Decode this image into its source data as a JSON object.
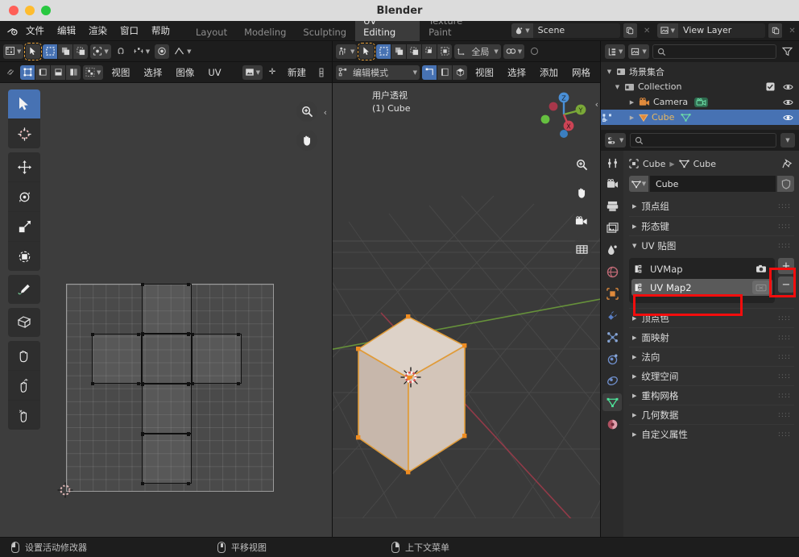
{
  "window": {
    "title": "Blender"
  },
  "topbar": {
    "menus": [
      "文件",
      "编辑",
      "渲染",
      "窗口",
      "帮助"
    ],
    "workspaces": [
      {
        "label": "Layout",
        "active": false
      },
      {
        "label": "Modeling",
        "active": false
      },
      {
        "label": "Sculpting",
        "active": false
      },
      {
        "label": "UV Editing",
        "active": true
      },
      {
        "label": "Texture Paint",
        "active": false
      }
    ],
    "scene": {
      "label": "Scene"
    },
    "view_layer": {
      "label": "View Layer"
    }
  },
  "uv_editor": {
    "header_row2": {
      "menus": [
        "视图",
        "选择",
        "图像",
        "UV"
      ],
      "new_button": "新建"
    }
  },
  "viewport": {
    "header_row2": {
      "mode": "编辑模式",
      "menus": [
        "视图",
        "选择",
        "添加",
        "网格"
      ]
    },
    "header_row1": {
      "orientation": "全局"
    },
    "overlay_text_line1": "用户透视",
    "overlay_text_line2": "(1) Cube",
    "gizmo_axes": [
      "X",
      "Y",
      "Z"
    ]
  },
  "outliner": {
    "root": "场景集合",
    "items": [
      {
        "label": "Collection",
        "type": "collection",
        "selected": false
      },
      {
        "label": "Camera",
        "type": "camera",
        "selected": false
      },
      {
        "label": "Cube",
        "type": "mesh",
        "selected": true
      }
    ]
  },
  "properties": {
    "breadcrumb": [
      "Cube",
      "Cube"
    ],
    "datablock_name": "Cube",
    "panels_above": [
      "顶点组",
      "形态键"
    ],
    "uv_panel": {
      "title": "UV 贴图",
      "items": [
        {
          "label": "UVMap",
          "selected": false
        },
        {
          "label": "UV Map2",
          "selected": true
        }
      ],
      "add_button": "+",
      "remove_button": "−"
    },
    "panels_below": [
      "顶点色",
      "面映射",
      "法向",
      "纹理空间",
      "重构网格",
      "几何数据",
      "自定义属性"
    ]
  },
  "statusbar": {
    "items": [
      {
        "label": "设置活动修改器",
        "mouse": "left"
      },
      {
        "label": "平移视图",
        "mouse": "mid"
      },
      {
        "label": "上下文菜单",
        "mouse": "right"
      }
    ]
  },
  "colors": {
    "accent_blue": "#4772b3",
    "annotation_red": "#f40d0d",
    "select_orange": "#e8a33d",
    "header_bg": "#1d1d1d"
  },
  "chart_data": null
}
